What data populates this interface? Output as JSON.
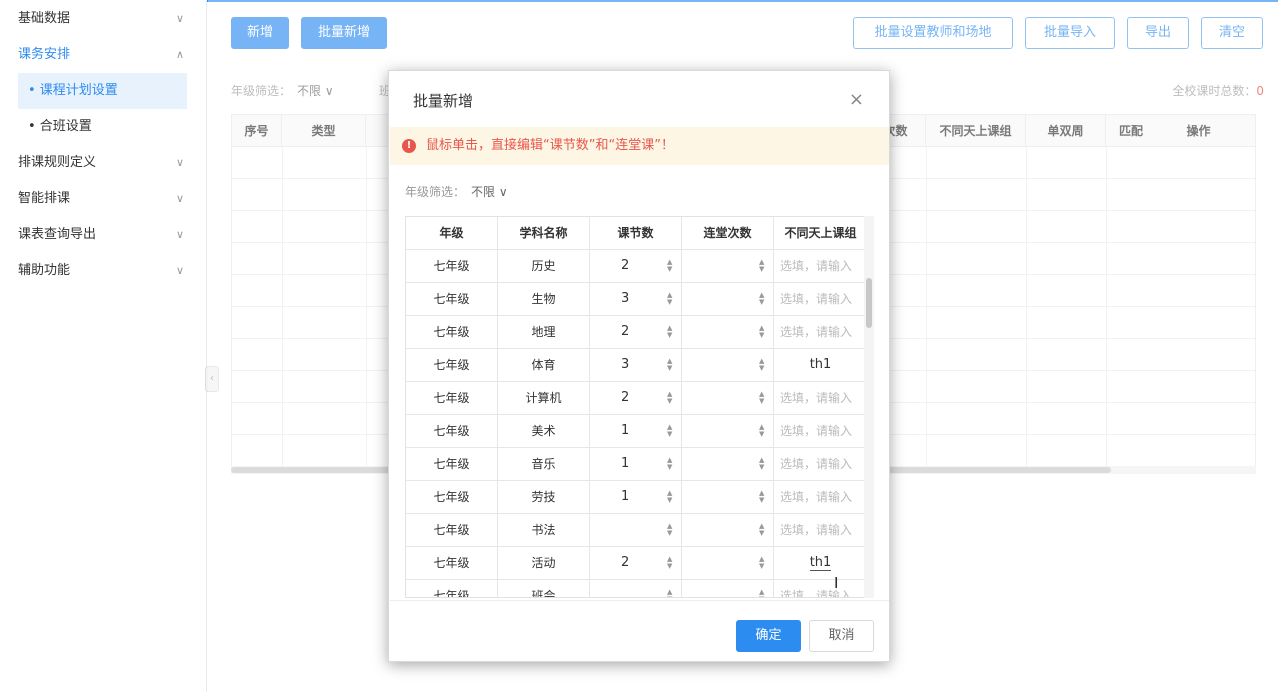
{
  "sidebar": {
    "items": [
      {
        "label": "基础数据",
        "chevron": "∨"
      },
      {
        "label": "课务安排",
        "chevron": "∧"
      },
      {
        "label": "排课规则定义",
        "chevron": "∨"
      },
      {
        "label": "智能排课",
        "chevron": "∨"
      },
      {
        "label": "课表查询导出",
        "chevron": "∨"
      },
      {
        "label": "辅助功能",
        "chevron": "∨"
      }
    ],
    "sub_items": [
      {
        "label": "• 课程计划设置"
      },
      {
        "label": "• 合班设置"
      }
    ],
    "collapse_glyph": "‹"
  },
  "toolbar": {
    "add": "新增",
    "batch_add": "批量新增",
    "batch_set": "批量设置教师和场地",
    "batch_import": "批量导入",
    "export": "导出",
    "clear": "清空"
  },
  "main": {
    "filter_label": "年级筛选：",
    "filter_value": "不限 ∨",
    "filter2_label": "班",
    "total_label": "全校课时总数：",
    "total_value": "0",
    "headers": [
      "序号",
      "类型",
      "次数",
      "不同天上课组",
      "单双周",
      "匹配",
      "操作"
    ]
  },
  "modal": {
    "title": "批量新增",
    "close": "×",
    "notice_icon": "!",
    "notice": "鼠标单击，直接编辑“课节数”和“连堂课”！",
    "filter_label": "年级筛选：",
    "filter_value": "不限 ∨",
    "headers": [
      "年级",
      "学科名称",
      "课节数",
      "连堂次数",
      "不同天上课组"
    ],
    "placeholder": "选填，请输入",
    "rows": [
      {
        "grade": "七年级",
        "subject": "历史",
        "periods": "2",
        "consecutive": "",
        "group": ""
      },
      {
        "grade": "七年级",
        "subject": "生物",
        "periods": "3",
        "consecutive": "",
        "group": ""
      },
      {
        "grade": "七年级",
        "subject": "地理",
        "periods": "2",
        "consecutive": "",
        "group": ""
      },
      {
        "grade": "七年级",
        "subject": "体育",
        "periods": "3",
        "consecutive": "",
        "group": "th1"
      },
      {
        "grade": "七年级",
        "subject": "计算机",
        "periods": "2",
        "consecutive": "",
        "group": ""
      },
      {
        "grade": "七年级",
        "subject": "美术",
        "periods": "1",
        "consecutive": "",
        "group": ""
      },
      {
        "grade": "七年级",
        "subject": "音乐",
        "periods": "1",
        "consecutive": "",
        "group": ""
      },
      {
        "grade": "七年级",
        "subject": "劳技",
        "periods": "1",
        "consecutive": "",
        "group": ""
      },
      {
        "grade": "七年级",
        "subject": "书法",
        "periods": "",
        "consecutive": "",
        "group": ""
      },
      {
        "grade": "七年级",
        "subject": "活动",
        "periods": "2",
        "consecutive": "",
        "group": "th1"
      },
      {
        "grade": "七年级",
        "subject": "班会",
        "periods": "",
        "consecutive": "",
        "group": ""
      }
    ],
    "confirm": "确定",
    "cancel": "取消"
  }
}
